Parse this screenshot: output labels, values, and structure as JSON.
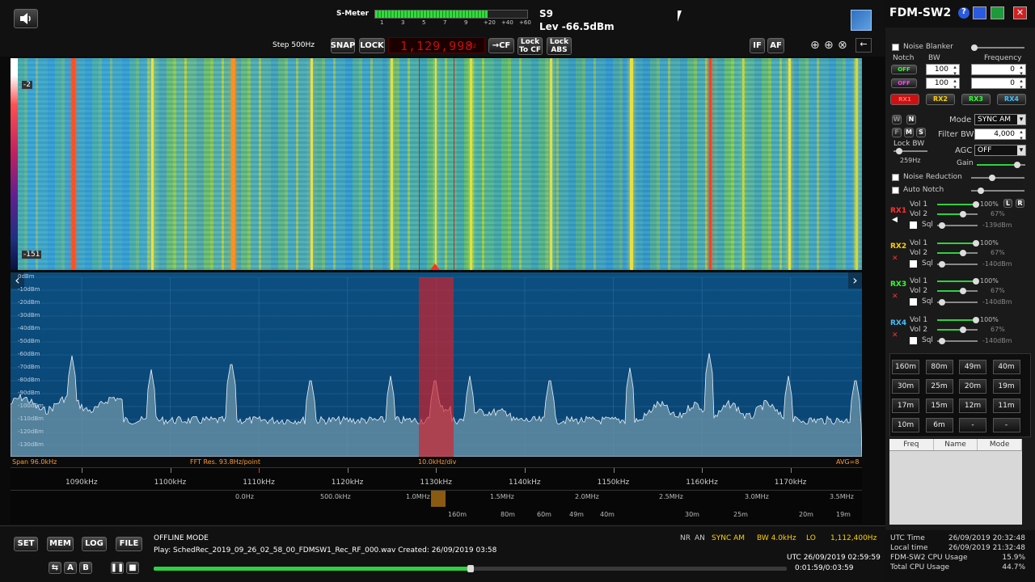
{
  "top": {
    "smeter_label": "S-Meter",
    "smeter_scale": [
      "1",
      "3",
      "5",
      "7",
      "9",
      "+20",
      "+40",
      "+60"
    ],
    "smeter_fill": 0.74,
    "s_reading": "S9",
    "level": "Lev -66.5dBm",
    "step": "Step 500Hz",
    "snap": "SNAP",
    "lock": "LOCK",
    "freq_display": "1,129,998",
    "freq_unit": "Hz",
    "cf": "→CF",
    "lock_to_cf": "Lock To CF",
    "lock_abs": "Lock ABS",
    "if": "IF",
    "af": "AF"
  },
  "waterfall": {
    "top_db": "-2",
    "bottom_db": "-151"
  },
  "spectrum": {
    "db_labels": [
      "0dBm",
      "-10dBm",
      "-20dBm",
      "-30dBm",
      "-40dBm",
      "-50dBm",
      "-60dBm",
      "-70dBm",
      "-80dBm",
      "-90dBm",
      "-100dBm",
      "-110dBm",
      "-120dBm",
      "-130dBm"
    ],
    "span": "Span 96.0kHz",
    "fft": "FFT Res. 93.8Hz/point",
    "div": "10.0kHz/div",
    "avg": "AVG=8"
  },
  "scale": {
    "khz": [
      "1090kHz",
      "1100kHz",
      "1110kHz",
      "1120kHz",
      "1130kHz",
      "1140kHz",
      "1150kHz",
      "1160kHz",
      "1170kHz"
    ],
    "mhz": [
      "0.0Hz",
      "500.0kHz",
      "1.0MHz",
      "1.5MHz",
      "2.0MHz",
      "2.5MHz",
      "3.0MHz",
      "3.5MHz"
    ],
    "meters": [
      "160m",
      "80m",
      "60m",
      "49m",
      "40m",
      "30m",
      "25m",
      "20m",
      "19m"
    ]
  },
  "bottom": {
    "set": "SET",
    "mem": "MEM",
    "log": "LOG",
    "file": "FILE",
    "a": "A",
    "b": "B",
    "mode_text": "OFFLINE MODE",
    "play_text": "Play: SchedRec_2019_09_26_02_58_00_FDMSW1_Rec_RF_000.wav Created: 26/09/2019 03:58",
    "nr": "NR",
    "an": "AN",
    "sync": "SYNC AM",
    "bw": "BW 4.0kHz",
    "lo": "LO",
    "lo_freq": "1,112,400Hz",
    "utc_stamp": "UTC 26/09/2019 02:59:59",
    "time_pos": "0:01:59/0:03:59",
    "progress": 0.5
  },
  "panel": {
    "title": "FDM-SW2",
    "noise_blanker": "Noise Blanker",
    "notch": "Notch",
    "bw": "BW",
    "frequency": "Frequency",
    "notch_rows": [
      {
        "state": "OFF",
        "bw": "100",
        "freq": "0"
      },
      {
        "state": "OFF",
        "bw": "100",
        "freq": "0"
      }
    ],
    "rx_tabs": [
      "RX1",
      "RX2",
      "RX3",
      "RX4"
    ],
    "w": "W",
    "n": "N",
    "f": "F",
    "m": "M",
    "s": "S",
    "mode_label": "Mode",
    "mode_value": "SYNC AM",
    "filter_bw_label": "Filter BW",
    "filter_bw_value": "4,000",
    "lock_bw": "Lock BW",
    "agc_label": "AGC",
    "agc_value": "OFF",
    "hz_value": "259Hz",
    "gain": "Gain",
    "noise_reduction": "Noise Reduction",
    "auto_notch": "Auto Notch",
    "l": "L",
    "r": "R",
    "receivers": [
      {
        "name": "RX1",
        "vol1": "Vol 1",
        "vol1_val": "100%",
        "vol2": "Vol 2",
        "vol2_val": "67%",
        "sql": "Sql",
        "sql_val": "-139dBm",
        "color": "#ff3030"
      },
      {
        "name": "RX2",
        "vol1": "Vol 1",
        "vol1_val": "100%",
        "vol2": "Vol 2",
        "vol2_val": "67%",
        "sql": "Sql",
        "sql_val": "-140dBm",
        "color": "#ffd000"
      },
      {
        "name": "RX3",
        "vol1": "Vol 1",
        "vol1_val": "100%",
        "vol2": "Vol 2",
        "vol2_val": "67%",
        "sql": "Sql",
        "sql_val": "-140dBm",
        "color": "#30ff30"
      },
      {
        "name": "RX4",
        "vol1": "Vol 1",
        "vol1_val": "100%",
        "vol2": "Vol 2",
        "vol2_val": "67%",
        "sql": "Sql",
        "sql_val": "-140dBm",
        "color": "#40c0ff"
      }
    ],
    "bands": [
      "160m",
      "80m",
      "49m",
      "40m",
      "30m",
      "25m",
      "20m",
      "19m",
      "17m",
      "15m",
      "12m",
      "11m",
      "10m",
      "6m",
      "-",
      "-"
    ],
    "mem_cols": [
      "Freq",
      "Name",
      "Mode"
    ],
    "stats": [
      {
        "label": "UTC Time",
        "value": "26/09/2019 20:32:48"
      },
      {
        "label": "Local time",
        "value": "26/09/2019 21:32:48"
      },
      {
        "label": "FDM-SW2 CPU Usage",
        "value": "15.9%"
      },
      {
        "label": "Total CPU Usage",
        "value": "44.7%"
      }
    ]
  }
}
